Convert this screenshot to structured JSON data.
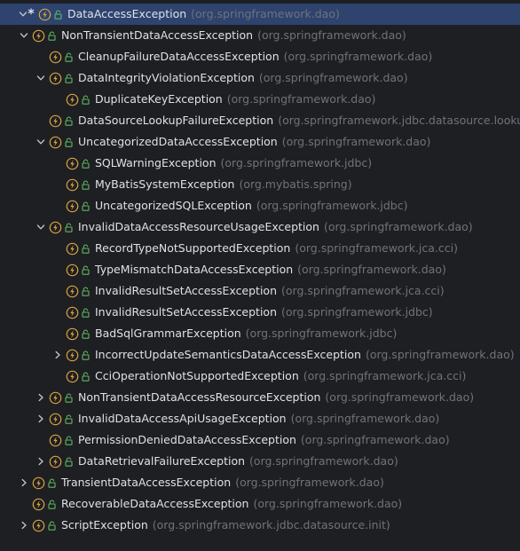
{
  "colors": {
    "background": "#1e1f22",
    "selection": "#2e436e",
    "text": "#dfe1e5",
    "package_text": "#6f737a",
    "exception_icon": "#d9a343",
    "lock_icon": "#5fb865"
  },
  "icons": {
    "expanded": "chevron-down-icon",
    "collapsed": "chevron-right-icon",
    "exception": "exception-class-icon",
    "visibility": "public-lock-icon"
  },
  "tree": {
    "rows": [
      {
        "name": "DataAccessException",
        "package": "(org.springframework.dao)",
        "level": 0,
        "state": "expanded",
        "selected": true,
        "marker": "*"
      },
      {
        "name": "NonTransientDataAccessException",
        "package": "(org.springframework.dao)",
        "level": 0,
        "state": "expanded"
      },
      {
        "name": "CleanupFailureDataAccessException",
        "package": "(org.springframework.dao)",
        "level": 1,
        "state": "leaf"
      },
      {
        "name": "DataIntegrityViolationException",
        "package": "(org.springframework.dao)",
        "level": 1,
        "state": "expanded"
      },
      {
        "name": "DuplicateKeyException",
        "package": "(org.springframework.dao)",
        "level": 2,
        "state": "leaf"
      },
      {
        "name": "DataSourceLookupFailureException",
        "package": "(org.springframework.jdbc.datasource.lookup)",
        "level": 1,
        "state": "leaf"
      },
      {
        "name": "UncategorizedDataAccessException",
        "package": "(org.springframework.dao)",
        "level": 1,
        "state": "expanded"
      },
      {
        "name": "SQLWarningException",
        "package": "(org.springframework.jdbc)",
        "level": 2,
        "state": "leaf"
      },
      {
        "name": "MyBatisSystemException",
        "package": "(org.mybatis.spring)",
        "level": 2,
        "state": "leaf"
      },
      {
        "name": "UncategorizedSQLException",
        "package": "(org.springframework.jdbc)",
        "level": 2,
        "state": "leaf"
      },
      {
        "name": "InvalidDataAccessResourceUsageException",
        "package": "(org.springframework.dao)",
        "level": 1,
        "state": "expanded"
      },
      {
        "name": "RecordTypeNotSupportedException",
        "package": "(org.springframework.jca.cci)",
        "level": 2,
        "state": "leaf"
      },
      {
        "name": "TypeMismatchDataAccessException",
        "package": "(org.springframework.dao)",
        "level": 2,
        "state": "leaf"
      },
      {
        "name": "InvalidResultSetAccessException",
        "package": "(org.springframework.jca.cci)",
        "level": 2,
        "state": "leaf"
      },
      {
        "name": "InvalidResultSetAccessException",
        "package": "(org.springframework.jdbc)",
        "level": 2,
        "state": "leaf"
      },
      {
        "name": "BadSqlGrammarException",
        "package": "(org.springframework.jdbc)",
        "level": 2,
        "state": "leaf"
      },
      {
        "name": "IncorrectUpdateSemanticsDataAccessException",
        "package": "(org.springframework.dao)",
        "level": 2,
        "state": "collapsed"
      },
      {
        "name": "CciOperationNotSupportedException",
        "package": "(org.springframework.jca.cci)",
        "level": 2,
        "state": "leaf"
      },
      {
        "name": "NonTransientDataAccessResourceException",
        "package": "(org.springframework.dao)",
        "level": 1,
        "state": "collapsed"
      },
      {
        "name": "InvalidDataAccessApiUsageException",
        "package": "(org.springframework.dao)",
        "level": 1,
        "state": "collapsed"
      },
      {
        "name": "PermissionDeniedDataAccessException",
        "package": "(org.springframework.dao)",
        "level": 1,
        "state": "leaf"
      },
      {
        "name": "DataRetrievalFailureException",
        "package": "(org.springframework.dao)",
        "level": 1,
        "state": "collapsed"
      },
      {
        "name": "TransientDataAccessException",
        "package": "(org.springframework.dao)",
        "level": 0,
        "state": "collapsed"
      },
      {
        "name": "RecoverableDataAccessException",
        "package": "(org.springframework.dao)",
        "level": 0,
        "state": "leaf"
      },
      {
        "name": "ScriptException",
        "package": "(org.springframework.jdbc.datasource.init)",
        "level": 0,
        "state": "collapsed"
      }
    ]
  }
}
